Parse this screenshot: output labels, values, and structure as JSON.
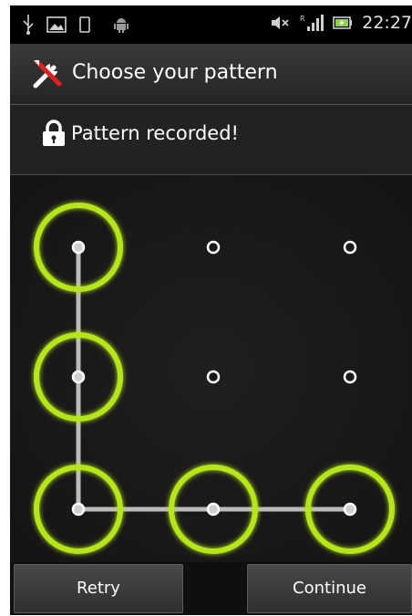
{
  "status_bar": {
    "time": "22:27",
    "icons": [
      "usb-icon",
      "image-notification-icon",
      "device-icon",
      "android-debug-icon",
      "mute-icon",
      "signal-icon",
      "battery-icon"
    ]
  },
  "title_bar": {
    "icon": "tools-icon",
    "title": "Choose your pattern"
  },
  "header": {
    "icon": "lock-icon",
    "message": "Pattern recorded!"
  },
  "pattern": {
    "grid": "3x3",
    "selected_nodes": [
      1,
      4,
      7,
      8,
      9
    ],
    "path_order": [
      1,
      4,
      7,
      8,
      9
    ],
    "highlight_color": "#b5e61d",
    "line_color": "#d8d8d8"
  },
  "buttons": {
    "retry_label": "Retry",
    "continue_label": "Continue"
  },
  "colors": {
    "status_bar_bg": "#000000",
    "screen_bg": "#1a1a1a"
  }
}
